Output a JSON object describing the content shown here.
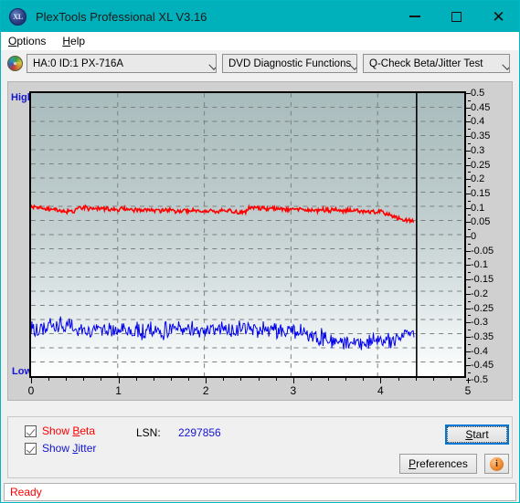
{
  "window": {
    "title": "PlexTools Professional XL V3.16",
    "app_icon": "xl-disc-icon",
    "icon_text": "XL",
    "titlebar_color": "#00b0ba",
    "minimize_label": "—",
    "maximize_label": "",
    "close_label": "✕"
  },
  "menubar": {
    "items": [
      {
        "label": "Options",
        "accel": "O"
      },
      {
        "label": "Help",
        "accel": "H"
      }
    ]
  },
  "toolbar": {
    "drive_icon": "cd-disc-icon",
    "drive_select": {
      "value": "HA:0 ID:1  PX-716A",
      "options": [
        "HA:0 ID:1  PX-716A"
      ]
    },
    "function_select": {
      "value": "DVD Diagnostic Functions",
      "options": [
        "DVD Diagnostic Functions"
      ]
    },
    "test_select": {
      "value": "Q-Check Beta/Jitter Test",
      "options": [
        "Q-Check Beta/Jitter Test"
      ]
    }
  },
  "chart_labels": {
    "high": "High",
    "low": "Low"
  },
  "controls": {
    "show_beta": {
      "label_pre": "Show ",
      "label_accel": "B",
      "label_post": "eta",
      "checked": true,
      "color": "#ff0000"
    },
    "show_jitter": {
      "label_pre": "Show ",
      "label_accel": "J",
      "label_post": "itter",
      "checked": true,
      "color": "#1414d2"
    },
    "lsn_label": "LSN:",
    "lsn_value": "2297856",
    "start_button": {
      "pre": "",
      "accel": "S",
      "post": "tart"
    },
    "preferences_button": {
      "pre": "",
      "accel": "P",
      "post": "references"
    },
    "info_button": {
      "icon": "info-icon",
      "glyph": "i"
    }
  },
  "statusbar": {
    "text": "Ready",
    "color": "#ff0000"
  },
  "chart_data": {
    "type": "line",
    "title": "Q-Check Beta/Jitter Test",
    "xlabel": "",
    "ylabel": "",
    "xlim": [
      0,
      5
    ],
    "ylim": [
      -0.5,
      0.5
    ],
    "xticks": [
      0,
      1,
      2,
      3,
      4,
      5
    ],
    "yticks": [
      0.5,
      0.45,
      0.4,
      0.35,
      0.3,
      0.25,
      0.2,
      0.15,
      0.1,
      0.05,
      0,
      -0.05,
      -0.1,
      -0.15,
      -0.2,
      -0.25,
      -0.3,
      -0.35,
      -0.4,
      -0.45,
      -0.5
    ],
    "grid": true,
    "grid_style": "dashed",
    "legend": [
      "Show Beta",
      "Show Jitter"
    ],
    "annotations": [
      {
        "type": "vline",
        "x": 4.45,
        "color": "#000000",
        "label": "cursor"
      },
      {
        "type": "text",
        "text": "High",
        "position": "top-left",
        "color": "#1414d2"
      },
      {
        "type": "text",
        "text": "Low",
        "position": "bottom-left",
        "color": "#1414d2"
      }
    ],
    "series": [
      {
        "name": "Beta",
        "color": "#ff0000",
        "noise": 0.006,
        "x": [
          0.0,
          0.15,
          0.3,
          0.45,
          0.5,
          0.52,
          0.7,
          0.9,
          1.1,
          1.3,
          1.5,
          1.7,
          1.9,
          2.1,
          2.3,
          2.48,
          2.52,
          2.7,
          2.9,
          3.1,
          3.3,
          3.5,
          3.7,
          3.9,
          4.05,
          4.1,
          4.2,
          4.3,
          4.42
        ],
        "y": [
          0.098,
          0.092,
          0.086,
          0.081,
          0.08,
          0.098,
          0.094,
          0.091,
          0.089,
          0.087,
          0.086,
          0.085,
          0.084,
          0.083,
          0.082,
          0.08,
          0.095,
          0.093,
          0.091,
          0.089,
          0.087,
          0.086,
          0.084,
          0.082,
          0.08,
          0.072,
          0.062,
          0.053,
          0.046
        ]
      },
      {
        "name": "Jitter",
        "color": "#0000ee",
        "noise": 0.022,
        "x": [
          0.0,
          0.1,
          0.18,
          0.22,
          0.25,
          0.35,
          0.45,
          0.55,
          0.7,
          0.9,
          1.1,
          1.3,
          1.5,
          1.7,
          1.9,
          2.05,
          2.2,
          2.4,
          2.6,
          2.8,
          3.0,
          3.15,
          3.3,
          3.45,
          3.6,
          3.75,
          3.9,
          4.05,
          4.2,
          4.35,
          4.42
        ],
        "y": [
          -0.335,
          -0.336,
          -0.33,
          -0.3,
          -0.325,
          -0.322,
          -0.325,
          -0.338,
          -0.34,
          -0.34,
          -0.339,
          -0.34,
          -0.341,
          -0.336,
          -0.334,
          -0.338,
          -0.334,
          -0.333,
          -0.332,
          -0.334,
          -0.338,
          -0.348,
          -0.362,
          -0.37,
          -0.374,
          -0.38,
          -0.382,
          -0.376,
          -0.368,
          -0.352,
          -0.338
        ]
      }
    ]
  }
}
